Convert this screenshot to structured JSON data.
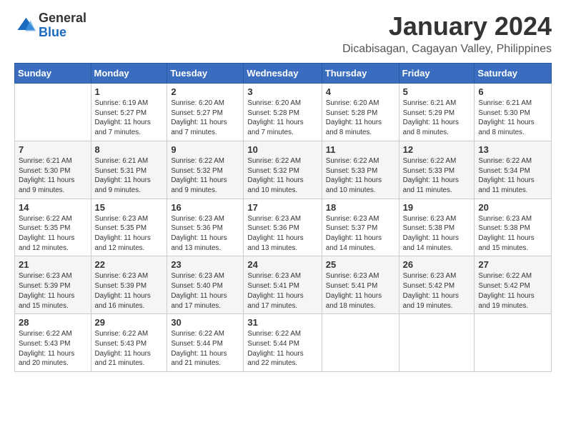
{
  "logo": {
    "general": "General",
    "blue": "Blue"
  },
  "title": "January 2024",
  "location": "Dicabisagan, Cagayan Valley, Philippines",
  "weekdays": [
    "Sunday",
    "Monday",
    "Tuesday",
    "Wednesday",
    "Thursday",
    "Friday",
    "Saturday"
  ],
  "weeks": [
    [
      {
        "day": "",
        "info": ""
      },
      {
        "day": "1",
        "info": "Sunrise: 6:19 AM\nSunset: 5:27 PM\nDaylight: 11 hours\nand 7 minutes."
      },
      {
        "day": "2",
        "info": "Sunrise: 6:20 AM\nSunset: 5:27 PM\nDaylight: 11 hours\nand 7 minutes."
      },
      {
        "day": "3",
        "info": "Sunrise: 6:20 AM\nSunset: 5:28 PM\nDaylight: 11 hours\nand 7 minutes."
      },
      {
        "day": "4",
        "info": "Sunrise: 6:20 AM\nSunset: 5:28 PM\nDaylight: 11 hours\nand 8 minutes."
      },
      {
        "day": "5",
        "info": "Sunrise: 6:21 AM\nSunset: 5:29 PM\nDaylight: 11 hours\nand 8 minutes."
      },
      {
        "day": "6",
        "info": "Sunrise: 6:21 AM\nSunset: 5:30 PM\nDaylight: 11 hours\nand 8 minutes."
      }
    ],
    [
      {
        "day": "7",
        "info": "Sunrise: 6:21 AM\nSunset: 5:30 PM\nDaylight: 11 hours\nand 9 minutes."
      },
      {
        "day": "8",
        "info": "Sunrise: 6:21 AM\nSunset: 5:31 PM\nDaylight: 11 hours\nand 9 minutes."
      },
      {
        "day": "9",
        "info": "Sunrise: 6:22 AM\nSunset: 5:32 PM\nDaylight: 11 hours\nand 9 minutes."
      },
      {
        "day": "10",
        "info": "Sunrise: 6:22 AM\nSunset: 5:32 PM\nDaylight: 11 hours\nand 10 minutes."
      },
      {
        "day": "11",
        "info": "Sunrise: 6:22 AM\nSunset: 5:33 PM\nDaylight: 11 hours\nand 10 minutes."
      },
      {
        "day": "12",
        "info": "Sunrise: 6:22 AM\nSunset: 5:33 PM\nDaylight: 11 hours\nand 11 minutes."
      },
      {
        "day": "13",
        "info": "Sunrise: 6:22 AM\nSunset: 5:34 PM\nDaylight: 11 hours\nand 11 minutes."
      }
    ],
    [
      {
        "day": "14",
        "info": "Sunrise: 6:22 AM\nSunset: 5:35 PM\nDaylight: 11 hours\nand 12 minutes."
      },
      {
        "day": "15",
        "info": "Sunrise: 6:23 AM\nSunset: 5:35 PM\nDaylight: 11 hours\nand 12 minutes."
      },
      {
        "day": "16",
        "info": "Sunrise: 6:23 AM\nSunset: 5:36 PM\nDaylight: 11 hours\nand 13 minutes."
      },
      {
        "day": "17",
        "info": "Sunrise: 6:23 AM\nSunset: 5:36 PM\nDaylight: 11 hours\nand 13 minutes."
      },
      {
        "day": "18",
        "info": "Sunrise: 6:23 AM\nSunset: 5:37 PM\nDaylight: 11 hours\nand 14 minutes."
      },
      {
        "day": "19",
        "info": "Sunrise: 6:23 AM\nSunset: 5:38 PM\nDaylight: 11 hours\nand 14 minutes."
      },
      {
        "day": "20",
        "info": "Sunrise: 6:23 AM\nSunset: 5:38 PM\nDaylight: 11 hours\nand 15 minutes."
      }
    ],
    [
      {
        "day": "21",
        "info": "Sunrise: 6:23 AM\nSunset: 5:39 PM\nDaylight: 11 hours\nand 15 minutes."
      },
      {
        "day": "22",
        "info": "Sunrise: 6:23 AM\nSunset: 5:39 PM\nDaylight: 11 hours\nand 16 minutes."
      },
      {
        "day": "23",
        "info": "Sunrise: 6:23 AM\nSunset: 5:40 PM\nDaylight: 11 hours\nand 17 minutes."
      },
      {
        "day": "24",
        "info": "Sunrise: 6:23 AM\nSunset: 5:41 PM\nDaylight: 11 hours\nand 17 minutes."
      },
      {
        "day": "25",
        "info": "Sunrise: 6:23 AM\nSunset: 5:41 PM\nDaylight: 11 hours\nand 18 minutes."
      },
      {
        "day": "26",
        "info": "Sunrise: 6:23 AM\nSunset: 5:42 PM\nDaylight: 11 hours\nand 19 minutes."
      },
      {
        "day": "27",
        "info": "Sunrise: 6:22 AM\nSunset: 5:42 PM\nDaylight: 11 hours\nand 19 minutes."
      }
    ],
    [
      {
        "day": "28",
        "info": "Sunrise: 6:22 AM\nSunset: 5:43 PM\nDaylight: 11 hours\nand 20 minutes."
      },
      {
        "day": "29",
        "info": "Sunrise: 6:22 AM\nSunset: 5:43 PM\nDaylight: 11 hours\nand 21 minutes."
      },
      {
        "day": "30",
        "info": "Sunrise: 6:22 AM\nSunset: 5:44 PM\nDaylight: 11 hours\nand 21 minutes."
      },
      {
        "day": "31",
        "info": "Sunrise: 6:22 AM\nSunset: 5:44 PM\nDaylight: 11 hours\nand 22 minutes."
      },
      {
        "day": "",
        "info": ""
      },
      {
        "day": "",
        "info": ""
      },
      {
        "day": "",
        "info": ""
      }
    ]
  ]
}
